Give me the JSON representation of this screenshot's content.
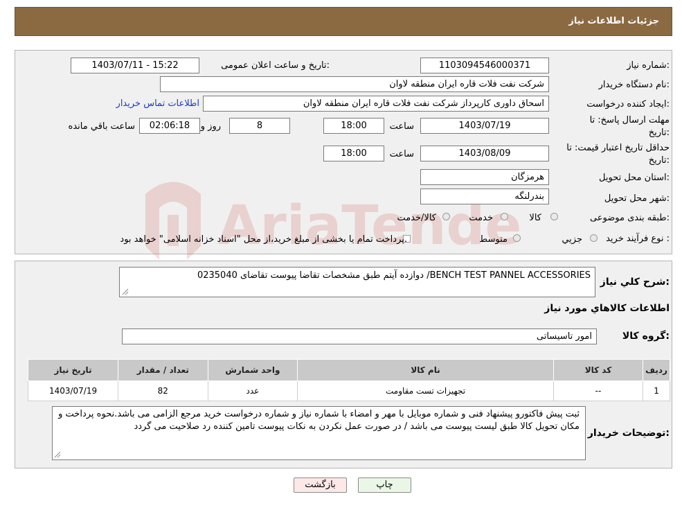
{
  "header": {
    "title": "جزئیات اطلاعات نیاز"
  },
  "fields": {
    "need_number_label": "شماره نیاز:",
    "need_number": "1103094546000371",
    "announce_label": "تاریخ و ساعت اعلان عمومی:",
    "announce_value": "1403/07/11 - 15:22",
    "buyer_org_label": "نام دستگاه خریدار:",
    "buyer_org": "شرکت نفت فلات قاره ایران منطقه لاوان",
    "creator_label": "ایجاد کننده درخواست:",
    "creator": "اسحاق داوری کارپرداز شرکت نفت فلات قاره ایران منطقه لاوان",
    "contact_link": "اطلاعات تماس خریدار",
    "deadline_label_1": "مهلت ارسال پاسخ: تا",
    "deadline_label_2": "تاریخ:",
    "deadline_date": "1403/07/19",
    "time_label": "ساعت",
    "deadline_time": "18:00",
    "days_value": "8",
    "days_label": "روز و",
    "remaining_time": "02:06:18",
    "remaining_label": "ساعت باقي مانده",
    "price_valid_label_1": "حداقل تاریخ اعتبار قیمت: تا",
    "price_valid_label_2": "تاریخ:",
    "price_valid_date": "1403/08/09",
    "price_valid_time": "18:00",
    "province_label": "استان محل تحویل:",
    "province": "هرمزگان",
    "city_label": "شهر محل تحویل:",
    "city": "بندرلنگه",
    "category_label": "طبقه بندی موضوعی:",
    "category_options": [
      "کالا",
      "خدمت",
      "کالا/خدمت"
    ],
    "process_label": "نوع فرآیند خرید :",
    "process_options": [
      "جزیي",
      "متوسط"
    ],
    "process_note": "پرداخت تمام یا بخشی از مبلغ خرید،از محل \"اسناد خزانه اسلامی\" خواهد بود."
  },
  "details": {
    "desc_label": "شرح کلي نياز:",
    "desc_value": "BENCH TEST PANNEL ACCESSORIES/ دوازده آیتم طبق مشخصات تقاضا پیوست تقاضای 0235040",
    "goods_info_title": "اطلاعات کالاهاي مورد نياز",
    "goods_group_label": "گروه کالا:",
    "goods_group": "امور تاسیساتی",
    "table": {
      "headers": [
        "رديف",
        "کد کالا",
        "نام کالا",
        "واحد شمارش",
        "تعداد / مقدار",
        "تاریخ نیاز"
      ],
      "rows": [
        [
          "1",
          "--",
          "تجهیزات تست مقاومت",
          "عدد",
          "82",
          "1403/07/19"
        ]
      ]
    },
    "buyer_notes_label": "توضیحات خریدار:",
    "buyer_notes": "ثبت پیش فاکتورو پیشنهاد فنی و شماره موبایل با مهر و امضاء با شماره نیاز و شماره درخواست خرید مرجع الزامی می باشد.نحوه پرداخت و مکان تحویل کالا طبق لیست پیوست می باشد / در صورت عمل نکردن به نکات پیوست تامین کننده رد صلاحیت می گردد"
  },
  "buttons": {
    "print": "چاپ",
    "back": "بازگشت"
  },
  "watermark": {
    "text": "AriaTender.neT"
  }
}
